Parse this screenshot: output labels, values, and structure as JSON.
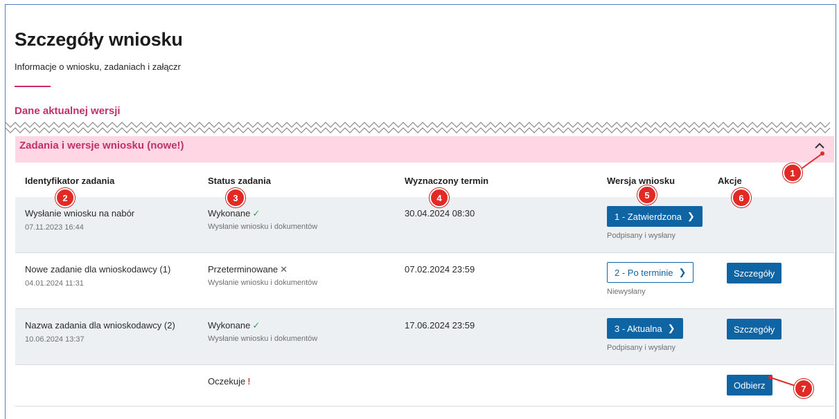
{
  "page": {
    "title": "Szczegóły wniosku",
    "subtitle": "Informacje o wniosku, zadaniach i załączr"
  },
  "section": {
    "current_version_label": "Dane aktualnej wersji"
  },
  "panel": {
    "title": "Zadania i wersje wniosku (nowe!)"
  },
  "table": {
    "headers": {
      "id": "Identyfikator zadania",
      "status": "Status zadania",
      "deadline": "Wyznaczony termin",
      "version": "Wersja wniosku",
      "actions": "Akcje"
    },
    "rows": [
      {
        "name": "Wysłanie wniosku na nabór",
        "date": "07.11.2023 16:44",
        "status": "Wykonane",
        "status_icon": "check-icon",
        "status_sub": "Wysłanie wniosku i dokumentów",
        "deadline": "30.04.2024 08:30",
        "version_label": "1 - Zatwierdzona",
        "version_style": "solid",
        "version_sub": "Podpisany i wysłany",
        "action": ""
      },
      {
        "name": "Nowe zadanie dla wnioskodawcy (1)",
        "date": "04.01.2024 11:31",
        "status": "Przeterminowane",
        "status_icon": "cross-icon",
        "status_sub": "Wysłanie wniosku i dokumentów",
        "deadline": "07.02.2024 23:59",
        "version_label": "2 - Po terminie",
        "version_style": "outline",
        "version_sub": "Niewysłany",
        "action": "Szczegóły"
      },
      {
        "name": "Nazwa zadania dla wnioskodawcy (2)",
        "date": "10.06.2024 13:37",
        "status": "Wykonane",
        "status_icon": "check-icon",
        "status_sub": "Wysłanie wniosku i dokumentów",
        "deadline": "17.06.2024 23:59",
        "version_label": "3 - Aktualna",
        "version_style": "solid",
        "version_sub": "Podpisany i wysłany",
        "action": "Szczegóły"
      },
      {
        "status": "Oczekuje",
        "status_icon": "exclamation-icon",
        "action": "Odbierz"
      }
    ]
  },
  "annotations": [
    "1",
    "2",
    "3",
    "4",
    "5",
    "6",
    "7"
  ],
  "colors": {
    "accent_pink": "#c2306a",
    "band_pink": "#ffd6e3",
    "button_blue": "#0f65a3",
    "badge_red": "#e12a25",
    "success_green": "#36a046"
  }
}
